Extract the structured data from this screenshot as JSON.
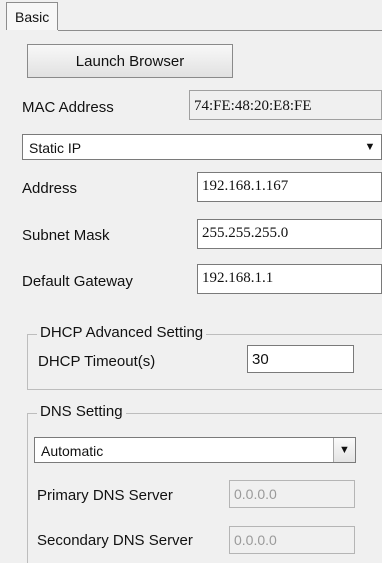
{
  "tabs": [
    {
      "label": "Basic"
    }
  ],
  "launch_button": {
    "label": "Launch Browser"
  },
  "mac": {
    "label": "MAC Address",
    "value": "74:FE:48:20:E8:FE"
  },
  "ip_mode": {
    "selected": "Static IP"
  },
  "address": {
    "label": "Address",
    "value": "192.168.1.167"
  },
  "subnet": {
    "label": "Subnet Mask",
    "value": "255.255.255.0"
  },
  "gateway": {
    "label": "Default Gateway",
    "value": "192.168.1.1"
  },
  "dhcp": {
    "legend": "DHCP Advanced Setting",
    "timeout_label": "DHCP Timeout(s)",
    "timeout_value": "30"
  },
  "dns": {
    "legend": "DNS Setting",
    "mode_selected": "Automatic",
    "primary_label": "Primary DNS Server",
    "primary_value": "0.0.0.0",
    "secondary_label": "Secondary DNS Server",
    "secondary_value": "0.0.0.0"
  },
  "icons": {
    "dropdown": "chevron-down-icon"
  }
}
